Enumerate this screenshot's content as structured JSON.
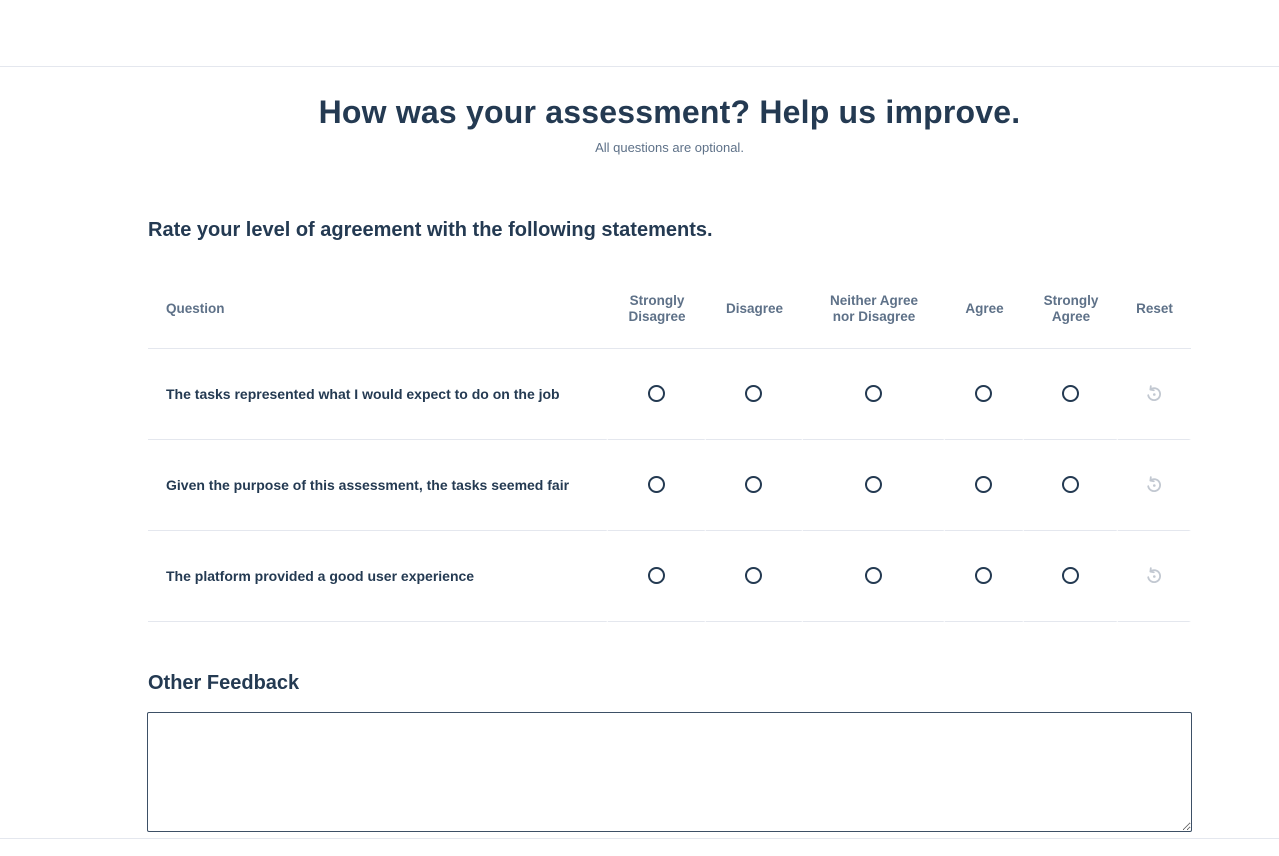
{
  "header": {
    "title": "How was your assessment? Help us improve.",
    "subtitle": "All questions are optional."
  },
  "rating_section": {
    "heading": "Rate your level of agreement with the following statements.",
    "columns": {
      "question": "Question",
      "strongly_disagree_line1": "Strongly",
      "strongly_disagree_line2": "Disagree",
      "disagree": "Disagree",
      "neither_line1": "Neither Agree",
      "neither_line2": "nor Disagree",
      "agree": "Agree",
      "strongly_agree_line1": "Strongly",
      "strongly_agree_line2": "Agree",
      "reset": "Reset"
    },
    "questions": [
      {
        "text": "The tasks represented what I would expect to do on the job",
        "selected": null
      },
      {
        "text": "Given the purpose of this assessment, the tasks seemed fair",
        "selected": null
      },
      {
        "text": "The platform provided a good user experience",
        "selected": null
      }
    ]
  },
  "feedback": {
    "heading": "Other Feedback",
    "value": "",
    "placeholder": ""
  },
  "colors": {
    "text_primary": "#243a52",
    "text_secondary": "#5e7188",
    "divider": "#e4e7ee",
    "reset_icon": "#c2c8d1"
  },
  "icons": {
    "reset": "reset-icon"
  }
}
